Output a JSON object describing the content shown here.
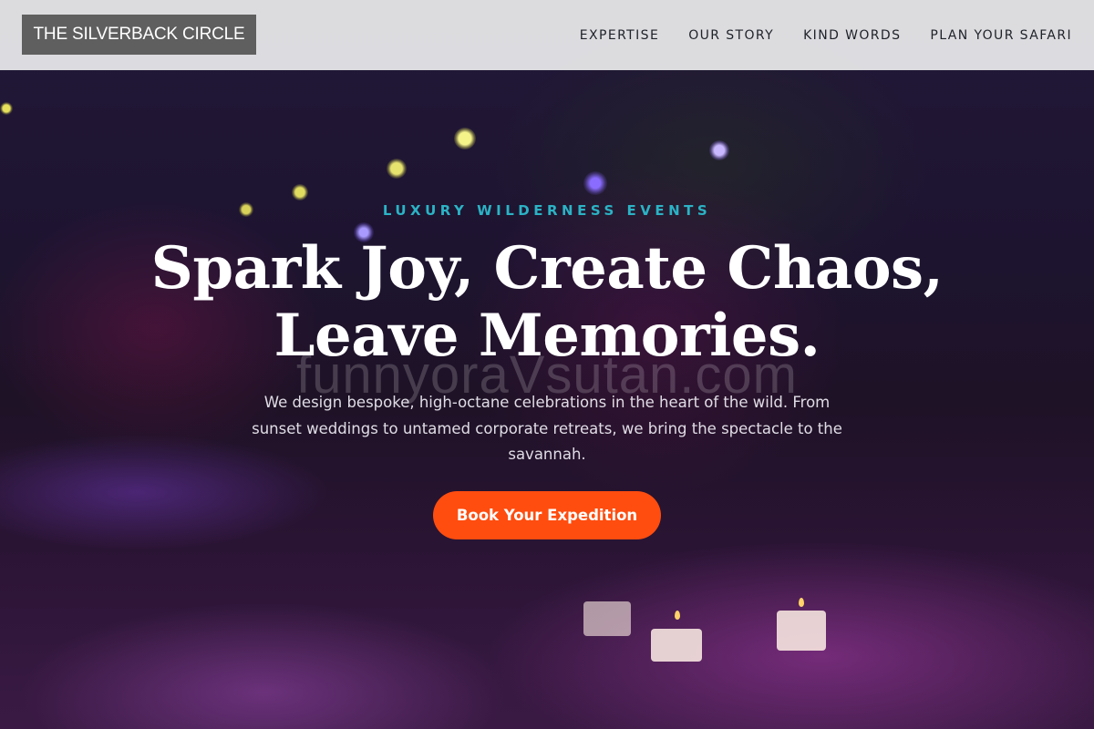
{
  "nav": {
    "logo": "THE SILVERBACK CIRCLE",
    "links": [
      "EXPERTISE",
      "OUR STORY",
      "KIND WORDS",
      "PLAN YOUR SAFARI"
    ]
  },
  "hero": {
    "eyebrow": "LUXURY WILDERNESS EVENTS",
    "headline_line1": "Spark Joy, Create Chaos,",
    "headline_line2": "Leave Memories.",
    "description": "We design bespoke, high-octane celebrations in the heart of the wild. From sunset weddings to untamed corporate retreats, we bring the spectacle to the savannah.",
    "cta_label": "Book Your Expedition",
    "watermark": "funnyoraVsutan.com"
  },
  "colors": {
    "accent_cta": "#ff4d0f",
    "eyebrow": "#2bb3c5",
    "logo_bg": "#5f5f5f",
    "nav_bg": "#e4e4e6"
  }
}
